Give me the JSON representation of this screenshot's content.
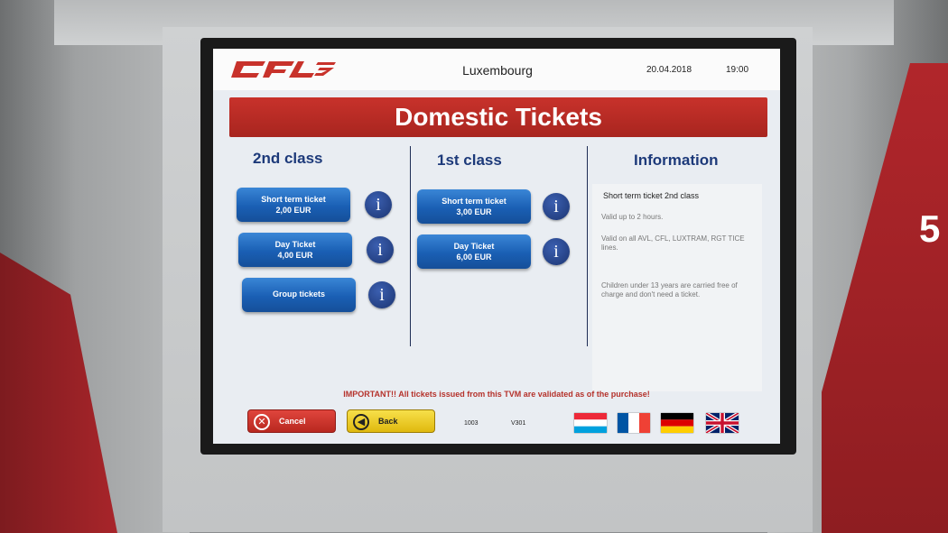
{
  "header": {
    "logo_text": "CFL",
    "city": "Luxembourg",
    "date": "20.04.2018",
    "time": "19:00"
  },
  "banner": {
    "title": "Domestic Tickets"
  },
  "columns": {
    "second_class": "2nd class",
    "first_class": "1st class",
    "information": "Information"
  },
  "second_class_tickets": [
    {
      "name": "Short term ticket",
      "price": "2,00 EUR"
    },
    {
      "name": "Day Ticket",
      "price": "4,00 EUR"
    },
    {
      "name": "Group tickets",
      "price": ""
    }
  ],
  "first_class_tickets": [
    {
      "name": "Short term ticket",
      "price": "3,00 EUR"
    },
    {
      "name": "Day Ticket",
      "price": "6,00 EUR"
    }
  ],
  "info_icon_glyph": "i",
  "info": {
    "title": "Short term ticket 2nd class",
    "p1": "Valid up to 2 hours.",
    "p2": "Valid on all AVL, CFL, LUXTRAM, RGT TICE lines.",
    "p3": "Children under 13 years are carried free of charge and don't need a ticket."
  },
  "notice": "IMPORTANT!! All tickets issued from this TVM are validated as of the purchase!",
  "footer": {
    "cancel_label": "Cancel",
    "back_label": "Back",
    "code1": "1003",
    "code2": "V301"
  },
  "kiosk_number": "5",
  "colors": {
    "cfl_red": "#c8322b",
    "button_blue": "#1a5fb4",
    "heading_blue": "#1d3a7a",
    "back_yellow": "#f2d230"
  },
  "icons": [
    "x-circle-icon",
    "arrow-left-circle-icon",
    "info-icon"
  ]
}
